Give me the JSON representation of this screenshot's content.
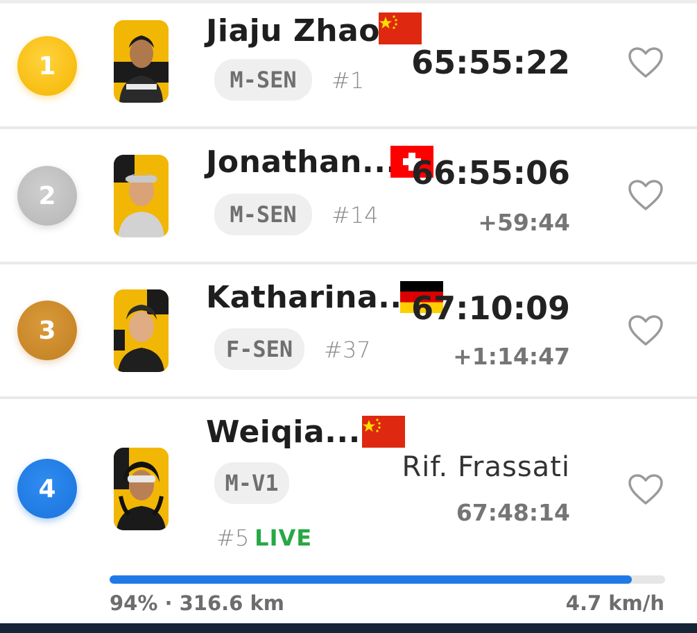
{
  "athletes": [
    {
      "rank": "1",
      "name": "Jiaju Zhao",
      "country": "China",
      "category": "M-SEN",
      "bib": "#1",
      "time": "65:55:22",
      "gap": ""
    },
    {
      "rank": "2",
      "name": "Jonathan...",
      "country": "Switzerland",
      "category": "M-SEN",
      "bib": "#14",
      "time": "66:55:06",
      "gap": "+59:44"
    },
    {
      "rank": "3",
      "name": "Katharina...",
      "country": "Germany",
      "category": "F-SEN",
      "bib": "#37",
      "time": "67:10:09",
      "gap": "+1:14:47"
    },
    {
      "rank": "4",
      "name": "Weiqia...",
      "country": "China",
      "category": "M-V1",
      "bib": "#5",
      "status": "LIVE",
      "location": "Rif. Frassati",
      "time": "67:48:14",
      "progress_percent": 94,
      "progress_text": "94% · 316.6 km",
      "speed": "4.7 km/h"
    }
  ],
  "colors": {
    "gold": "#f5b400",
    "silver": "#b5b5b5",
    "bronze": "#c07f22",
    "blue": "#1a73dc",
    "live": "#27a844",
    "progress": "#1f7ae8"
  }
}
